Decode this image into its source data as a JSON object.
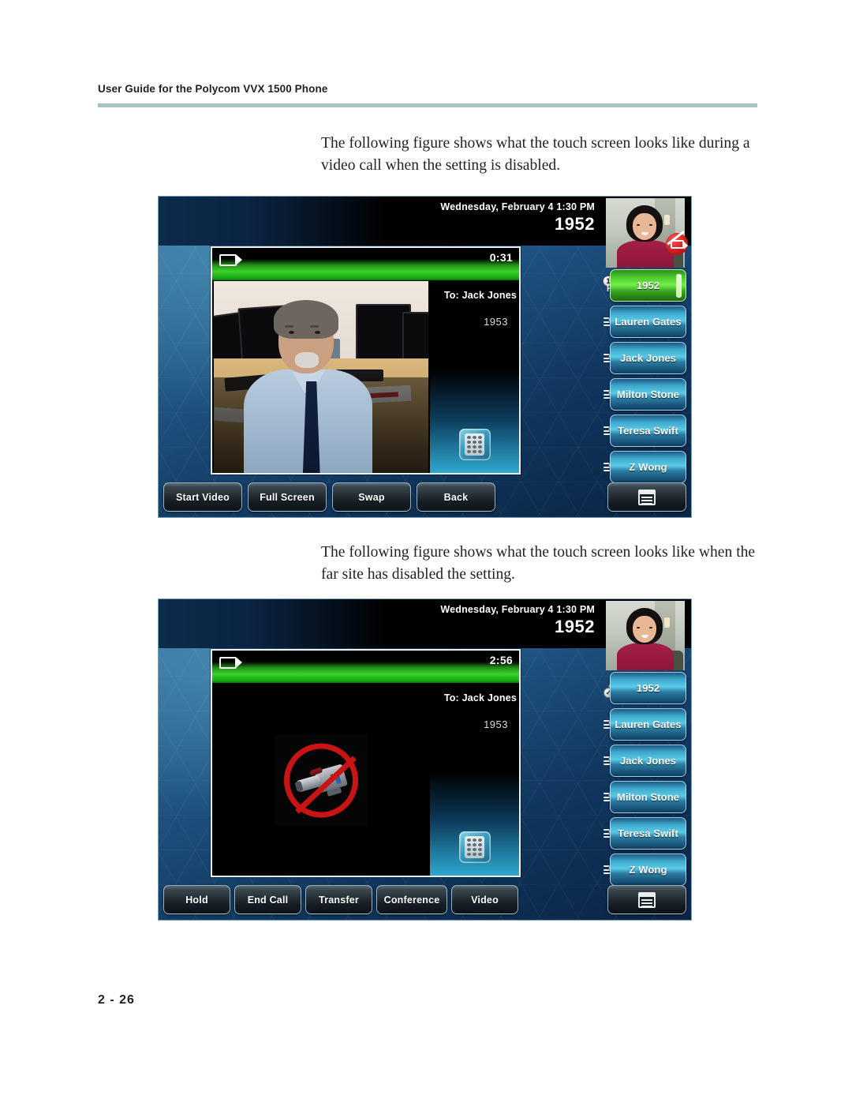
{
  "document": {
    "running_header": "User Guide for the Polycom VVX 1500 Phone",
    "page_number": "2 - 26",
    "paragraphs": {
      "first": "The following figure shows what the touch screen looks like during a video call when the setting is disabled.",
      "second": "The following figure shows what the touch screen looks like when the far site has disabled the setting."
    }
  },
  "figure1": {
    "caption_ref": "video call when the setting is disabled",
    "statusbar": {
      "datetime": "Wednesday, February 4  1:30 PM",
      "extension": "1952"
    },
    "selfview": {
      "camera_off_badge": true,
      "badge_color": "#d01b1b"
    },
    "call": {
      "timer": "0:31",
      "to_label": "To: Jack Jones",
      "remote_number": "1953",
      "camera_icon": "video-camera-icon",
      "keypad_icon": "keypad-icon",
      "bar_color": "#3ed12a"
    },
    "line_keys": [
      {
        "label": "1952",
        "state": "active",
        "color": "#4fce2d",
        "icon": "hd-line-icon",
        "line_number": "1",
        "hd_label": "HD"
      },
      {
        "label": "Lauren Gates",
        "state": "idle",
        "color": "#59cbe8",
        "icon": "handset-icon"
      },
      {
        "label": "Jack Jones",
        "state": "idle",
        "color": "#59cbe8",
        "icon": "handset-icon"
      },
      {
        "label": "Milton Stone",
        "state": "idle",
        "color": "#59cbe8",
        "icon": "handset-icon"
      },
      {
        "label": "Teresa Swift",
        "state": "idle",
        "color": "#59cbe8",
        "icon": "handset-icon"
      },
      {
        "label": "Z Wong",
        "state": "idle",
        "color": "#59cbe8",
        "icon": "handset-icon"
      }
    ],
    "soft_keys": [
      "Start Video",
      "Full Screen",
      "Swap",
      "Back"
    ],
    "menu_key_icon": "menu-icon"
  },
  "figure2": {
    "caption_ref": "far site has disabled the setting",
    "statusbar": {
      "datetime": "Wednesday, February 4  1:30 PM",
      "extension": "1952"
    },
    "selfview": {
      "camera_off_badge": false
    },
    "call": {
      "timer": "2:56",
      "to_label": "To: Jack Jones",
      "remote_number": "1953",
      "camera_icon": "video-camera-icon",
      "keypad_icon": "keypad-icon",
      "no_video_symbol": "no-camera-icon",
      "no_video_ring_color": "#c81414",
      "bar_color": "#3ed12a"
    },
    "line_keys": [
      {
        "label": "1952",
        "state": "connected",
        "color": "#59cbe8",
        "icon": "handset-check-icon"
      },
      {
        "label": "Lauren Gates",
        "state": "idle",
        "color": "#59cbe8",
        "icon": "handset-icon"
      },
      {
        "label": "Jack Jones",
        "state": "idle",
        "color": "#59cbe8",
        "icon": "handset-icon"
      },
      {
        "label": "Milton Stone",
        "state": "idle",
        "color": "#59cbe8",
        "icon": "handset-icon"
      },
      {
        "label": "Teresa Swift",
        "state": "idle",
        "color": "#59cbe8",
        "icon": "handset-icon"
      },
      {
        "label": "Z Wong",
        "state": "idle",
        "color": "#59cbe8",
        "icon": "handset-icon"
      }
    ],
    "soft_keys": [
      "Hold",
      "End Call",
      "Transfer",
      "Conference",
      "Video"
    ],
    "menu_key_icon": "menu-icon"
  }
}
